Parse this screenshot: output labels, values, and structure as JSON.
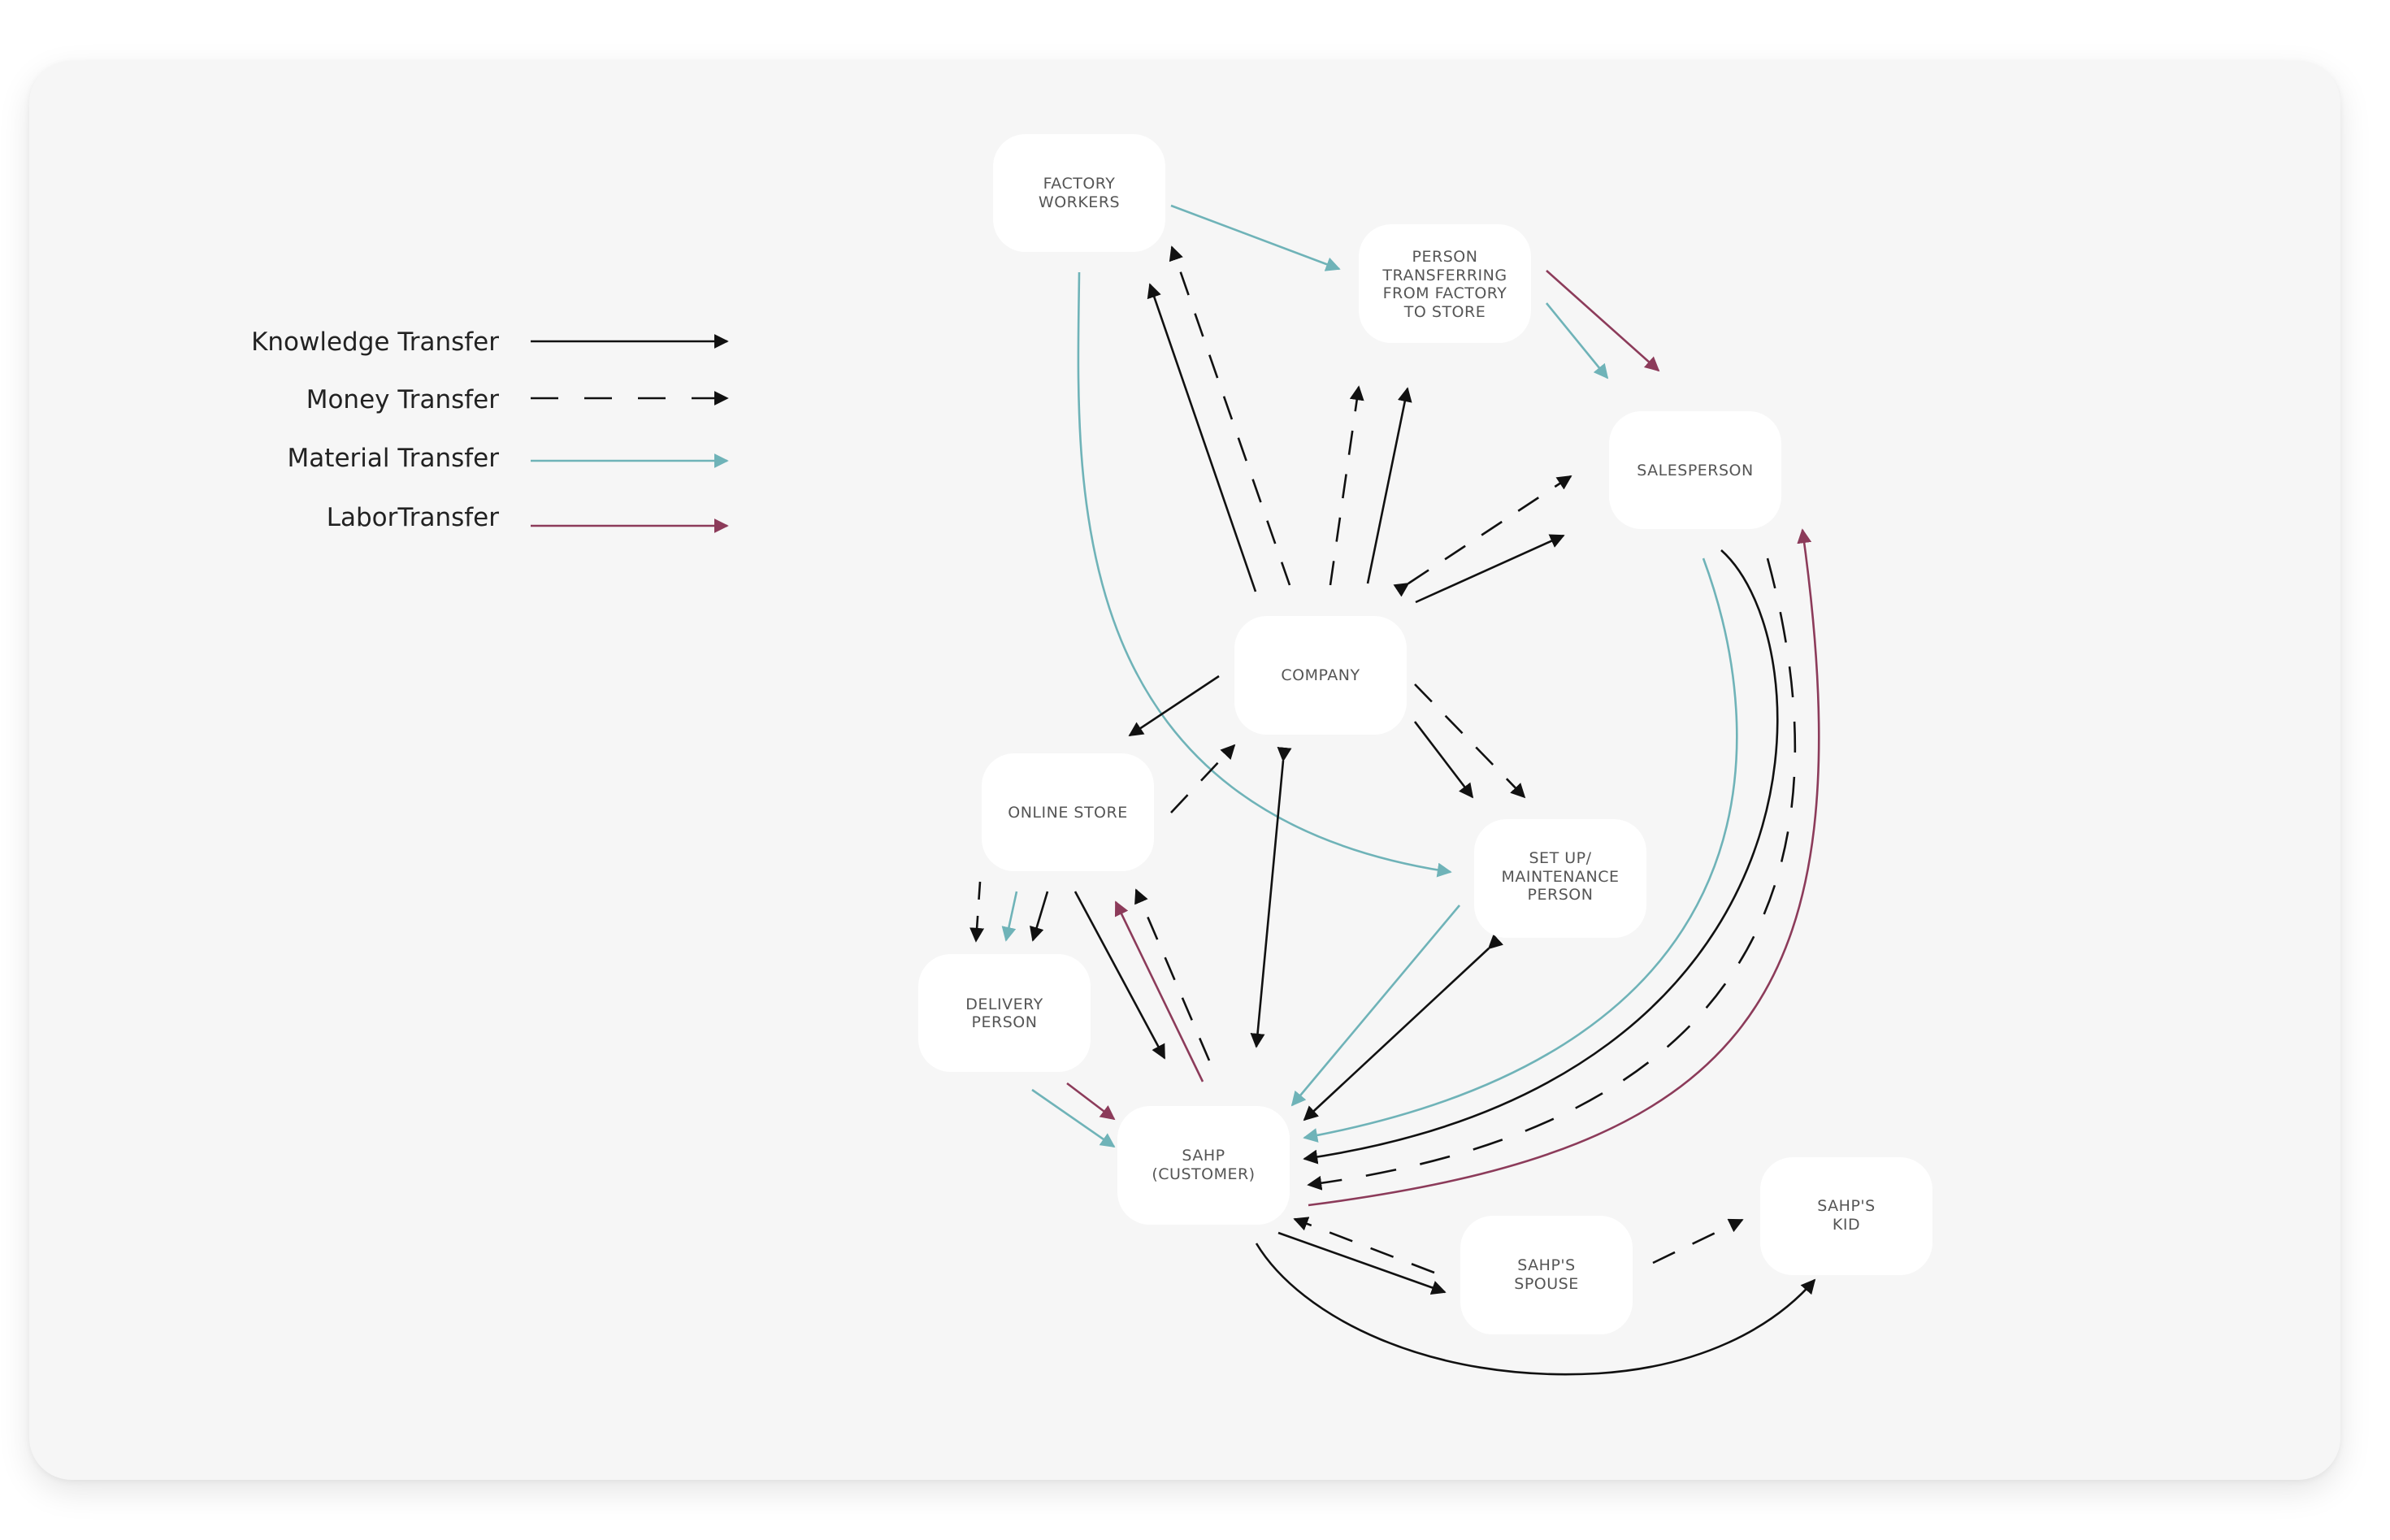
{
  "colors": {
    "knowledge": "#111111",
    "money": "#111111",
    "material": "#6fb3b8",
    "labor": "#8c3b5a",
    "card_background": "#f6f6f6",
    "node_fill": "#ffffff",
    "node_text": "#555555"
  },
  "legend": [
    {
      "label": "Knowledge Transfer",
      "style": "solid",
      "color": "#111111"
    },
    {
      "label": "Money Transfer",
      "style": "dashed",
      "color": "#111111"
    },
    {
      "label": "Material Transfer",
      "style": "solid",
      "color": "#6fb3b8"
    },
    {
      "label": "LaborTransfer",
      "style": "solid",
      "color": "#8c3b5a"
    }
  ],
  "nodes": {
    "factory": [
      "FACTORY",
      "WORKERS"
    ],
    "transfer": [
      "PERSON",
      "TRANSFERRING",
      "FROM FACTORY",
      "TO STORE"
    ],
    "salesperson": [
      "SALESPERSON"
    ],
    "company": [
      "COMPANY"
    ],
    "online": [
      "ONLINE STORE"
    ],
    "setup": [
      "SET UP/",
      "MAINTENANCE",
      "PERSON"
    ],
    "delivery": [
      "DELIVERY",
      "PERSON"
    ],
    "sahp": [
      "SAHP",
      "(CUSTOMER)"
    ],
    "spouse": [
      "SAHP'S",
      "SPOUSE"
    ],
    "kid": [
      "SAHP'S",
      "KID"
    ]
  }
}
